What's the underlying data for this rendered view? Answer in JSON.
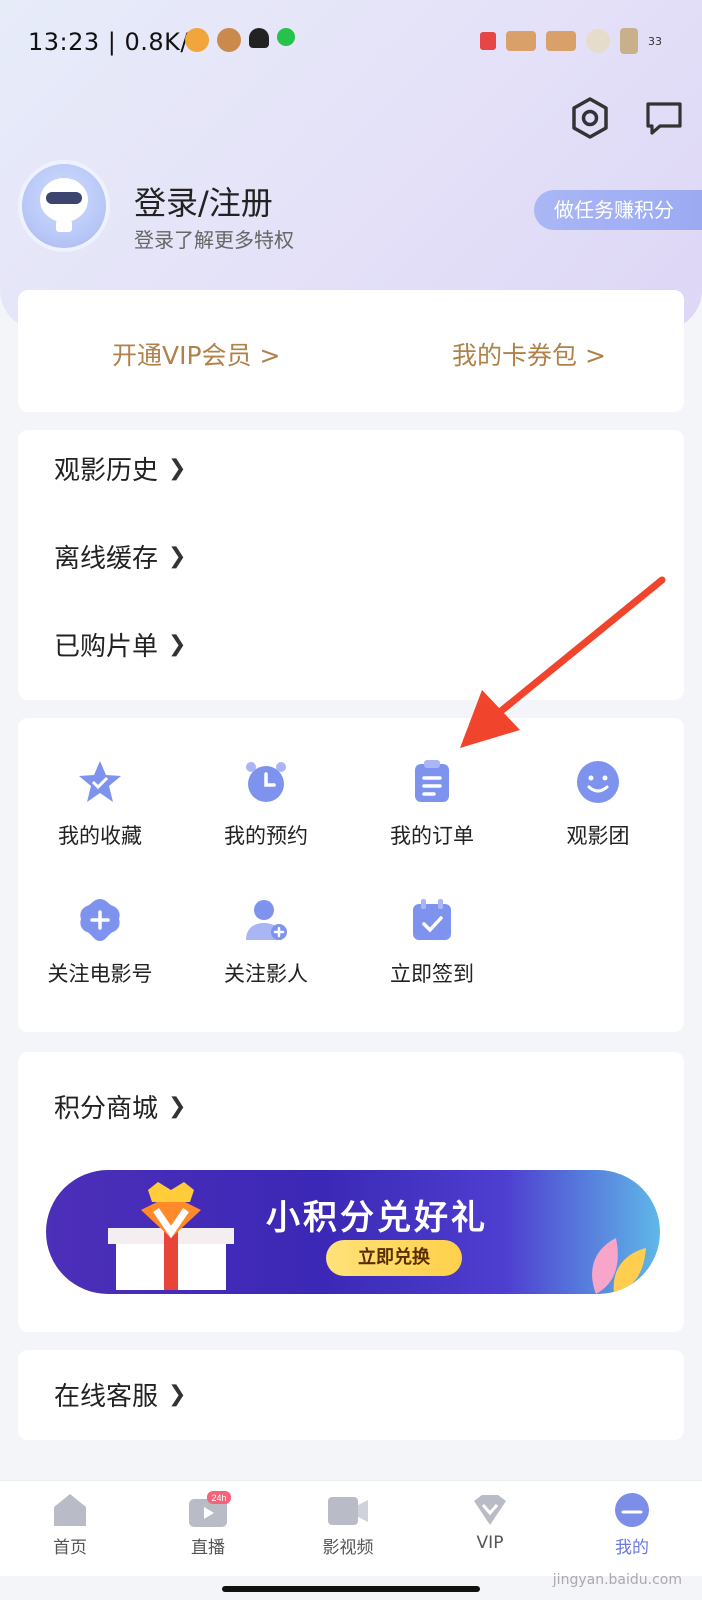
{
  "status_bar": {
    "time": "13:23 | 0.8K/s",
    "signal_label": "33"
  },
  "header": {
    "login_title": "登录/注册",
    "login_subtitle": "登录了解更多特权",
    "task_button": "做任务赚积分"
  },
  "vip_card": {
    "open_vip": "开通VIP会员 >",
    "coupons": "我的卡券包 >"
  },
  "list_items": [
    {
      "label": "观影历史"
    },
    {
      "label": "离线缓存"
    },
    {
      "label": "已购片单"
    }
  ],
  "grid_items": [
    {
      "label": "我的收藏",
      "icon": "star-icon"
    },
    {
      "label": "我的预约",
      "icon": "alarm-clock-icon"
    },
    {
      "label": "我的订单",
      "icon": "clipboard-icon"
    },
    {
      "label": "观影团",
      "icon": "smiley-icon"
    },
    {
      "label": "关注电影号",
      "icon": "add-badge-icon"
    },
    {
      "label": "关注影人",
      "icon": "add-person-icon"
    },
    {
      "label": "立即签到",
      "icon": "calendar-check-icon"
    }
  ],
  "points_mall": {
    "title": "积分商城",
    "banner_title": "小积分兑好礼",
    "banner_button": "立即兑换"
  },
  "customer_service": {
    "title": "在线客服"
  },
  "bottom_nav": {
    "items": [
      {
        "label": "首页"
      },
      {
        "label": "直播",
        "badge": "24h"
      },
      {
        "label": "影视频"
      },
      {
        "label": "VIP"
      },
      {
        "label": "我的"
      }
    ]
  },
  "watermark": "jingyan.baidu.com",
  "colors": {
    "accent": "#8a9cf0",
    "vip_gold": "#b0824a",
    "annotation_arrow": "#f0442c"
  }
}
